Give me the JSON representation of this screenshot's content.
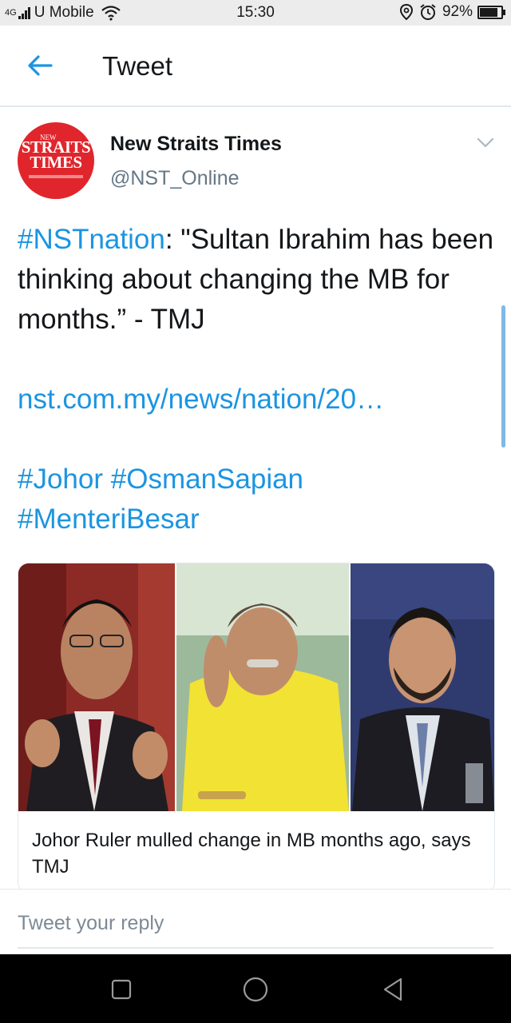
{
  "status_bar": {
    "network": "4G",
    "carrier": "U Mobile",
    "time": "15:30",
    "battery": "92%",
    "battery_level": 0.92,
    "icons": [
      "signal-icon",
      "wifi-icon",
      "location-icon",
      "alarm-icon",
      "battery-icon"
    ]
  },
  "header": {
    "title": "Tweet",
    "back_icon": "arrow-left-icon"
  },
  "tweet": {
    "author_name": "New Straits Times",
    "author_handle": "@NST_Online",
    "avatar_text_1": "NEW",
    "avatar_text_2": "STRAITS",
    "avatar_text_3": "TIMES",
    "hashtag_1": "#NSTnation",
    "text_1": ": \"Sultan Ibrahim has been thinking about changing the MB for months.” - TMJ",
    "link": "nst.com.my/news/nation/20…",
    "hashtag_2": "#Johor",
    "hashtag_3": "#OsmanSapian",
    "hashtag_4": "#MenteriBesar",
    "caret_icon": "chevron-down-icon"
  },
  "card": {
    "title": "Johor Ruler mulled change in MB months ago, says TMJ",
    "image_icon": "news-photo-collage"
  },
  "reply": {
    "placeholder": "Tweet your reply"
  },
  "nav_bar": {
    "buttons": [
      "recents-square-icon",
      "home-circle-icon",
      "back-triangle-icon"
    ]
  },
  "colors": {
    "link": "#1b95e0",
    "text": "#14171a",
    "secondary": "#657786",
    "avatar_bg": "#e0262c"
  }
}
